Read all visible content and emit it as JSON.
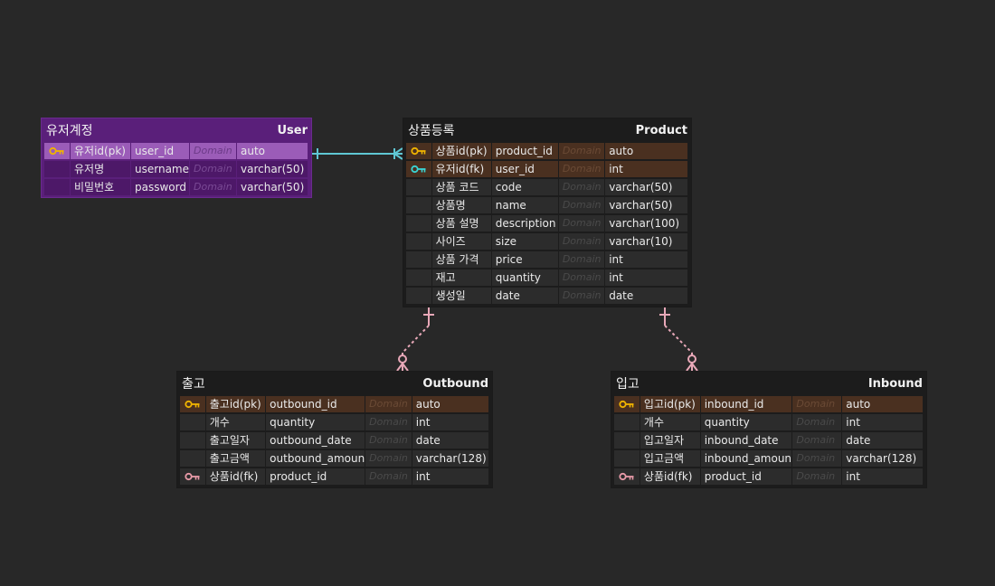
{
  "colors": {
    "background": "#282828",
    "table_bg": "#1c1c1c",
    "user_table_bg": "#5a1f7a",
    "pk_row": "#4a3020",
    "pk_key_icon": "#f0b400",
    "fk_key_icon_user": "#3ad6d6",
    "fk_key_icon_product": "#e89aa8",
    "relation_user_product": "#5fc7d4",
    "relation_product_children": "#e8a8b8"
  },
  "tables": {
    "user": {
      "logical_name": "유저계정",
      "physical_name": "User",
      "columns": [
        {
          "logical": "유저id(pk)",
          "physical": "user_id",
          "domain": "Domain",
          "type": "auto",
          "key": "pk"
        },
        {
          "logical": "유저명",
          "physical": "username",
          "domain": "Domain",
          "type": "varchar(50)",
          "key": ""
        },
        {
          "logical": "비밀번호",
          "physical": "password",
          "domain": "Domain",
          "type": "varchar(50)",
          "key": ""
        }
      ]
    },
    "product": {
      "logical_name": "상품등록",
      "physical_name": "Product",
      "columns": [
        {
          "logical": "상품id(pk)",
          "physical": "product_id",
          "domain": "Domain",
          "type": "auto",
          "key": "pk"
        },
        {
          "logical": "유저id(fk)",
          "physical": "user_id",
          "domain": "Domain",
          "type": "int",
          "key": "pfk"
        },
        {
          "logical": "상품 코드",
          "physical": "code",
          "domain": "Domain",
          "type": "varchar(50)",
          "key": ""
        },
        {
          "logical": "상품명",
          "physical": "name",
          "domain": "Domain",
          "type": "varchar(50)",
          "key": ""
        },
        {
          "logical": "상품 설명",
          "physical": "description",
          "domain": "Domain",
          "type": "varchar(100)",
          "key": ""
        },
        {
          "logical": "사이즈",
          "physical": "size",
          "domain": "Domain",
          "type": "varchar(10)",
          "key": ""
        },
        {
          "logical": "상품 가격",
          "physical": "price",
          "domain": "Domain",
          "type": "int",
          "key": ""
        },
        {
          "logical": "재고",
          "physical": "quantity",
          "domain": "Domain",
          "type": "int",
          "key": ""
        },
        {
          "logical": "생성일",
          "physical": "date",
          "domain": "Domain",
          "type": "date",
          "key": ""
        }
      ]
    },
    "outbound": {
      "logical_name": "출고",
      "physical_name": "Outbound",
      "columns": [
        {
          "logical": "출고id(pk)",
          "physical": "outbound_id",
          "domain": "Domain",
          "type": "auto",
          "key": "pk"
        },
        {
          "logical": "개수",
          "physical": "quantity",
          "domain": "Domain",
          "type": "int",
          "key": ""
        },
        {
          "logical": "출고일자",
          "physical": "outbound_date",
          "domain": "Domain",
          "type": "date",
          "key": ""
        },
        {
          "logical": "출고금액",
          "physical": "outbound_amount",
          "domain": "Domain",
          "type": "varchar(128)",
          "key": ""
        },
        {
          "logical": "상품id(fk)",
          "physical": "product_id",
          "domain": "Domain",
          "type": "int",
          "key": "fk"
        }
      ]
    },
    "inbound": {
      "logical_name": "입고",
      "physical_name": "Inbound",
      "columns": [
        {
          "logical": "입고id(pk)",
          "physical": "inbound_id",
          "domain": "Domain",
          "type": "auto",
          "key": "pk"
        },
        {
          "logical": "개수",
          "physical": "quantity",
          "domain": "Domain",
          "type": "int",
          "key": ""
        },
        {
          "logical": "입고일자",
          "physical": "inbound_date",
          "domain": "Domain",
          "type": "date",
          "key": ""
        },
        {
          "logical": "입고금액",
          "physical": "inbound_amount",
          "domain": "Domain",
          "type": "varchar(128)",
          "key": ""
        },
        {
          "logical": "상품id(fk)",
          "physical": "product_id",
          "domain": "Domain",
          "type": "int",
          "key": "fk"
        }
      ]
    }
  },
  "relations": [
    {
      "from": "user",
      "to": "product",
      "style": "solid",
      "color_key": "relation_user_product"
    },
    {
      "from": "product",
      "to": "outbound",
      "style": "dashed",
      "color_key": "relation_product_children"
    },
    {
      "from": "product",
      "to": "inbound",
      "style": "dashed",
      "color_key": "relation_product_children"
    }
  ]
}
